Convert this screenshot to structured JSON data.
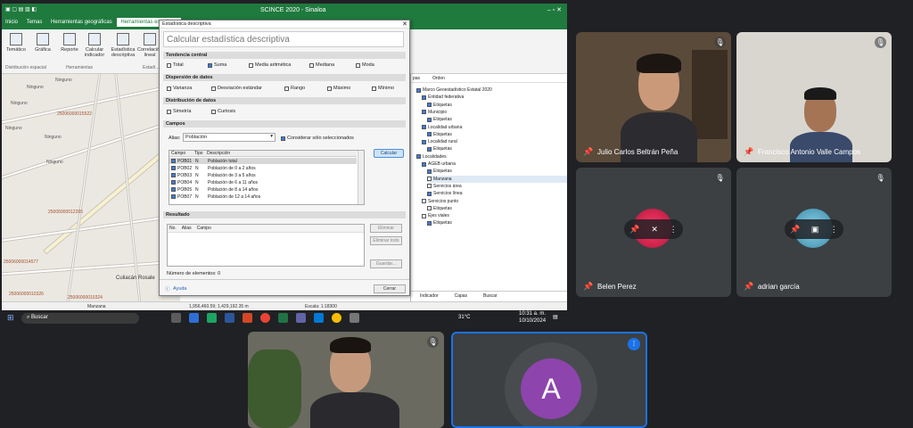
{
  "app": {
    "title": "SCINCE 2020 - Sinaloa",
    "tabs": [
      "Inicio",
      "Temas",
      "Herramientas geográficas",
      "Herramientas estadíst..."
    ],
    "ribbon_buttons": [
      "Temático",
      "Gráfica",
      "Reporte",
      "Calcular indicador",
      "Estadística descriptiva",
      "Correlación lineal"
    ],
    "ribbon_groups": [
      "Distribución espacial",
      "Herramientas",
      "Estadí..."
    ],
    "map_labels": [
      "Ninguno",
      "Ninguno",
      "Ninguno",
      "Ninguno",
      "Ninguno",
      "Ninguno",
      "25006000015522",
      "25006000012265",
      "25006000014577",
      "25006000010326",
      "25006000010324",
      "Culiacán Rosale",
      "Manzana"
    ],
    "status_coords": "1,956,460.59; 1,429,192.35 m",
    "status_scale": "Escala: 1:18300"
  },
  "dialog": {
    "title": "Estadística descriptiva",
    "heading": "Calcular estadística descriptiva",
    "sections": {
      "tendencia": "Tendencia central",
      "dispersion": "Dispersión de datos",
      "distribucion": "Distribución de datos",
      "campos": "Campos",
      "resultado": "Resultado"
    },
    "tendencia_opts": [
      "Total",
      "Suma",
      "Media aritmética",
      "Mediana",
      "Moda"
    ],
    "dispersion_opts": [
      "Varianza",
      "Desviación estándar",
      "Rango",
      "Máximo",
      "Mínimo"
    ],
    "distribucion_opts": [
      "Simetría",
      "Curtosis"
    ],
    "alias_label": "Alias:",
    "alias_value": "Población",
    "only_selected": "Considerar sólo seleccionados",
    "grid_headers": [
      "Campo",
      "Tipo",
      "Descripción"
    ],
    "grid_rows": [
      [
        "POB01",
        "N",
        "Población total"
      ],
      [
        "POB02",
        "N",
        "Población de 0 a 2 años"
      ],
      [
        "POB03",
        "N",
        "Población de 3 a 5 años"
      ],
      [
        "POB04",
        "N",
        "Población de 6 a 11 años"
      ],
      [
        "POB05",
        "N",
        "Población de 8 a 14 años"
      ],
      [
        "POB07",
        "N",
        "Población de 12 a 14 años"
      ]
    ],
    "calc_button": "Calcular",
    "result_headers": [
      "No.",
      "Alias",
      "Campo"
    ],
    "delete_button": "Eliminar",
    "delete_all_button": "Eliminar todo",
    "save_button": "Guardar...",
    "elements_count": "Número de elementos: 0",
    "help_link": "Ayuda",
    "close_button": "Cerrar"
  },
  "layers_panel": {
    "tabs": [
      "pas",
      "Orden"
    ],
    "items": [
      "Marco Geoestadístico Estatal 2020",
      "Entidad federativa",
      "Etiquetas",
      "Municipio",
      "Etiquetas",
      "Localidad urbana",
      "Etiquetas",
      "Localidad rural",
      "Etiquetas",
      "Localidades",
      "AGEB urbana",
      "Etiquetas",
      "Manzana",
      "Servicios área",
      "Servicios línea",
      "Servicios punto",
      "Etiquetas",
      "Ejes viales",
      "Etiquetas"
    ],
    "bottom_tabs": [
      "Indicador",
      "Capas",
      "Buscar"
    ]
  },
  "taskbar": {
    "search": "Buscar",
    "temp": "31°C",
    "time": "10:31 a. m.",
    "date": "10/10/2024"
  },
  "participants": {
    "p1": "Julio Carlos Beltrán Peña",
    "p2": "Francisco Antonio Valle Campos",
    "p3": "Belen Perez",
    "p4": "adrian garcía",
    "p6_initial": "A"
  },
  "colors": {
    "app_green": "#1f7a3e",
    "meet_bg": "#202124",
    "tile_bg": "#3c4043",
    "avatar_purple": "#8e44ad",
    "speaking_blue": "#1a73e8"
  }
}
